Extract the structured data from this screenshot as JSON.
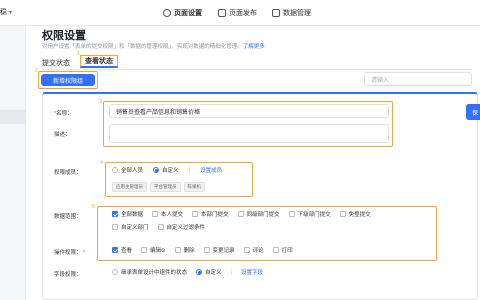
{
  "topbar": {
    "left_cut": "稳",
    "tabs": [
      {
        "label": "页面设置",
        "icon": "settings-icon"
      },
      {
        "label": "页面发布",
        "icon": "publish-icon"
      },
      {
        "label": "数据管理",
        "icon": "data-icon"
      }
    ]
  },
  "page": {
    "title": "权限设置",
    "subtitle": "对用户设置「表单的提交权限」和「数据的管理权限」，实现对数据的精细化管理。",
    "learn_more": "了解更多"
  },
  "tabs": {
    "submit": "提交状态",
    "view": "查看状态"
  },
  "markers": [
    "1",
    "2",
    "3",
    "4",
    "5"
  ],
  "new_group_button": "新增权限组",
  "search_placeholder": "请输入",
  "form": {
    "name_label": "名称：",
    "name_value": "销售员查看产品信息和销售价格",
    "desc_label": "描述：",
    "right_btn": "保",
    "members_label": "权限成员：",
    "members_options": [
      "全部人员",
      "自定义"
    ],
    "members_link": "设置成员",
    "member_tags": [
      "应用主管理员",
      "平台管理员",
      "陈果机"
    ],
    "scope_label": "数据范围：",
    "scope_options": [
      "全部数据",
      "本人提交",
      "本部门提交",
      "同级部门提交",
      "下级部门提交",
      "免登提交",
      "自定义部门",
      "自定义过滤条件"
    ],
    "ops_label": "操作权限：",
    "ops_options": [
      "查看",
      "编辑⊙",
      "删除",
      "变更记录",
      "评论",
      "打印"
    ],
    "fields_label": "字段权限：",
    "fields_options": [
      "继承表单设计中组件的状态",
      "自定义"
    ],
    "fields_link": "设置字段"
  }
}
